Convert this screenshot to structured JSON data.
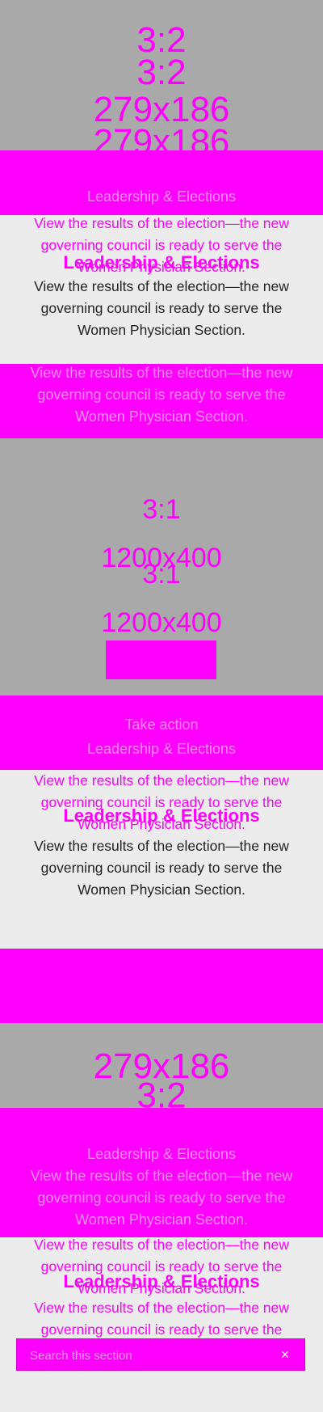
{
  "cards": [
    {
      "placeholder_ratio": "3:2",
      "placeholder_size": "279x186",
      "eyebrow": "",
      "title": "Leadership & Elections",
      "description": "View the results of the election—the new governing council is ready to serve the Women Physician Section."
    },
    {
      "placeholder_ratio": "3:1",
      "placeholder_size": "1200x400",
      "eyebrow": "Take action",
      "title": "Leadership & Elections",
      "description": "View the results of the election—the new governing council is ready to serve the Women Physician Section."
    },
    {
      "placeholder_ratio": "3:2",
      "placeholder_size": "279x186",
      "eyebrow": "",
      "title": "Leadership & Elections",
      "description": "View the results of the election—the new governing council is ready to serve the Women Physician Section."
    }
  ],
  "search": {
    "placeholder": "Search this section",
    "close_label": "×"
  },
  "colors": {
    "accent": "#ff00ff",
    "placeholder_bg": "#a9a9a9",
    "page_bg": "#ececec"
  }
}
